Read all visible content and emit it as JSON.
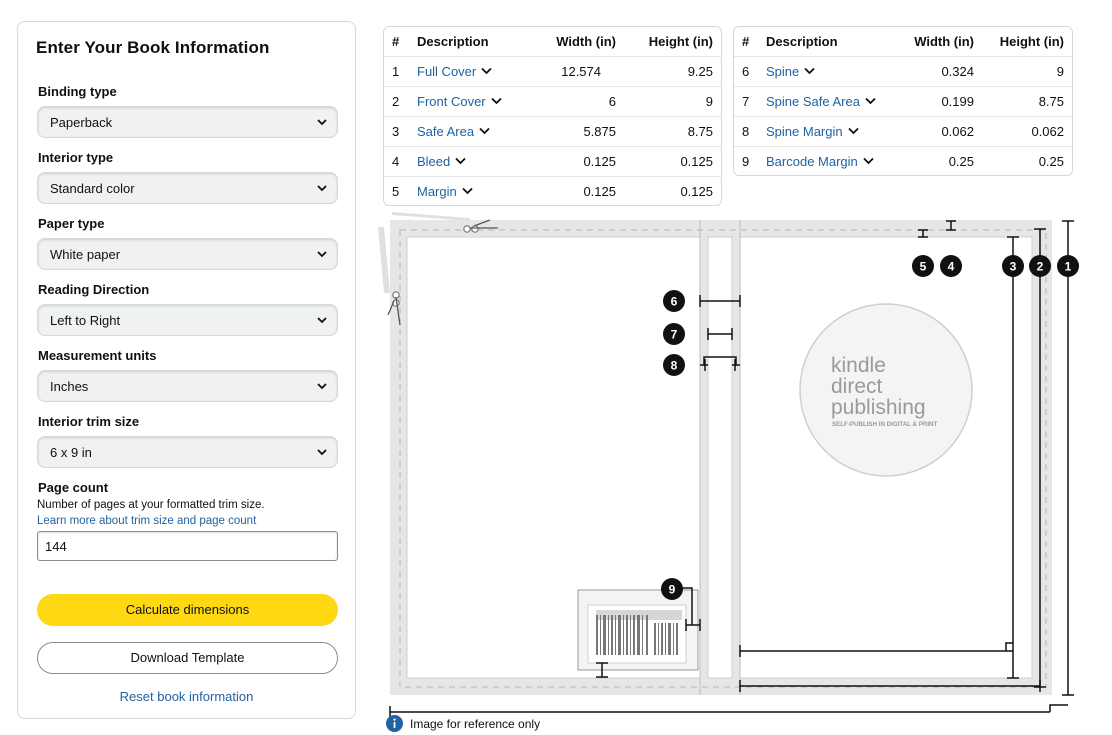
{
  "form": {
    "title": "Enter Your Book Information",
    "fields": [
      {
        "label": "Binding type",
        "value": "Paperback"
      },
      {
        "label": "Interior type",
        "value": "Standard color"
      },
      {
        "label": "Paper type",
        "value": "White paper"
      },
      {
        "label": "Reading Direction",
        "value": "Left to Right"
      },
      {
        "label": "Measurement units",
        "value": "Inches"
      },
      {
        "label": "Interior trim size",
        "value": "6 x 9 in"
      }
    ],
    "page_count": {
      "label": "Page count",
      "help": "Number of pages at your formatted trim size.",
      "link": "Learn more about trim size and page count",
      "value": "144"
    },
    "calculate_label": "Calculate dimensions",
    "download_label": "Download Template",
    "reset_label": "Reset book information"
  },
  "tables": {
    "headers": {
      "num": "#",
      "desc": "Description",
      "width": "Width (in)",
      "height": "Height (in)"
    },
    "left": [
      {
        "num": "1",
        "desc": "Full Cover",
        "width": "12.574",
        "height": "9.25"
      },
      {
        "num": "2",
        "desc": "Front Cover",
        "width": "6",
        "height": "9"
      },
      {
        "num": "3",
        "desc": "Safe Area",
        "width": "5.875",
        "height": "8.75"
      },
      {
        "num": "4",
        "desc": "Bleed",
        "width": "0.125",
        "height": "0.125"
      },
      {
        "num": "5",
        "desc": "Margin",
        "width": "0.125",
        "height": "0.125"
      }
    ],
    "right": [
      {
        "num": "6",
        "desc": "Spine",
        "width": "0.324",
        "height": "9"
      },
      {
        "num": "7",
        "desc": "Spine Safe Area",
        "width": "0.199",
        "height": "8.75"
      },
      {
        "num": "8",
        "desc": "Spine Margin",
        "width": "0.062",
        "height": "0.062"
      },
      {
        "num": "9",
        "desc": "Barcode Margin",
        "width": "0.25",
        "height": "0.25"
      }
    ]
  },
  "diagram": {
    "logo": {
      "line1": "kindle",
      "line2": "direct",
      "line3": "publishing",
      "tagline": "SELF-PUBLISH IN DIGITAL & PRINT"
    },
    "markers": [
      "1",
      "2",
      "3",
      "4",
      "5",
      "6",
      "7",
      "8",
      "9"
    ]
  },
  "reference_note": "Image for reference only",
  "colors": {
    "link": "#2162a1",
    "primary_button": "#ffd814",
    "border": "#d5d9d9",
    "select_bg": "#f0f2f2"
  },
  "icons": {
    "select": "chevron-down-icon",
    "description": "chevron-down-icon",
    "note": "info-icon",
    "diagram": "scissors-icon"
  }
}
